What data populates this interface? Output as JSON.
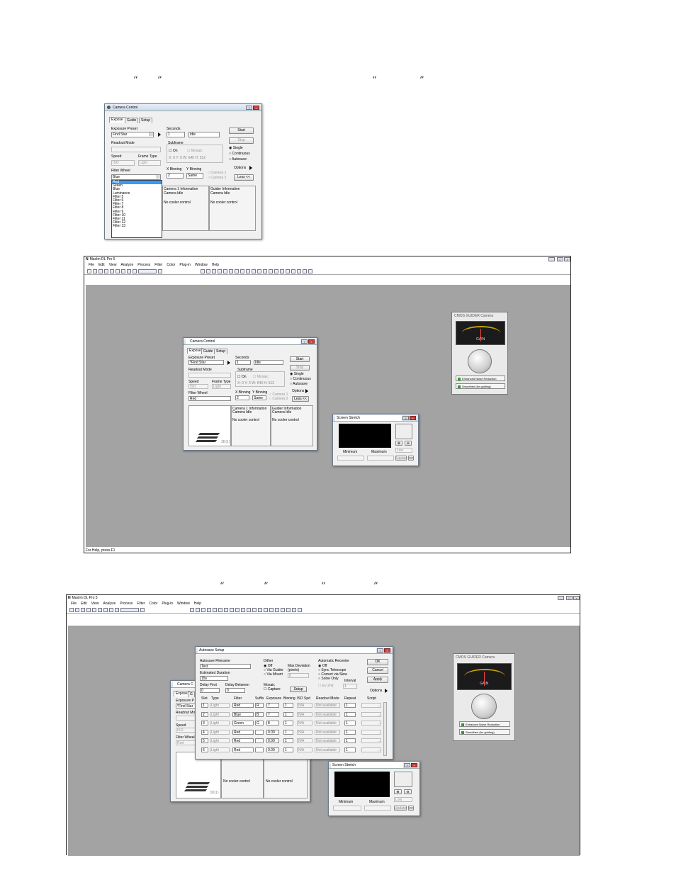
{
  "quotes": {
    "open": "“",
    "close": "”"
  },
  "camera_control": {
    "title": "Camera Control",
    "tabs": [
      "Expose",
      "Guide",
      "Setup"
    ],
    "exposure_preset_label": "Exposure Preset",
    "exposure_preset_value": "Find Star",
    "exposure_preset_value_2": "*Find Star",
    "seconds_label": "Seconds",
    "seconds_value": "1",
    "idle": "Idle",
    "start": "Start",
    "stop": "Stop",
    "readout_mode_label": "Readout Mode",
    "subframe_label": "Subframe",
    "on_label": "On",
    "mosaic_label": "Mosaic",
    "subframe_coords": "X: 0 Y: 0 W: 640 H: 512",
    "single": "Single",
    "continuous": "Continuous",
    "autosave": "Autosave",
    "speed_label": "Speed",
    "frame_type_label": "Frame Type",
    "speed_value": "ISO",
    "frame_type_value": "Light",
    "filter_wheel_label": "Filter Wheel",
    "filter_wheel_value": "Blue",
    "filter_wheel_value_2": "Red",
    "x_binning_label": "X Binning",
    "y_binning_label": "Y Binning",
    "x_binning_value": "2",
    "y_binning_value": "Same",
    "camera1": "Camera 1",
    "camera2": "Camera 2",
    "options": "Options",
    "less": "Less <<",
    "filter_options": [
      "Red",
      "Green",
      "Blue",
      "Luminance",
      "Filter 5",
      "Filter 6",
      "Filter 7",
      "Filter 8",
      "Filter 9",
      "Filter 10",
      "Filter 11",
      "Filter 12",
      "Filter 13"
    ],
    "camera_info_title": "Camera 1 Information",
    "camera_idle": "Camera Idle",
    "guider_info_title": "Guider Information",
    "no_cooler": "No cooler control",
    "logo_text": "3D(1)"
  },
  "maxim": {
    "title": "MaxIm DL Pro 5",
    "menus": [
      "File",
      "Edit",
      "View",
      "Analyze",
      "Process",
      "Filter",
      "Color",
      "Plug-in",
      "Window",
      "Help"
    ],
    "status": "For Help, press F1"
  },
  "cmos_guider": {
    "title": "CMOS GUIDER Camera",
    "scale": [
      "0",
      "10",
      "20",
      "30",
      "40",
      "50",
      "60",
      "70",
      "80",
      "90",
      "100"
    ],
    "gain_label": "GAIN",
    "noise_btn": "Enhanced Noise Reduction",
    "smooth_btn": "Smoothen (for guiding)"
  },
  "screen_stretch": {
    "title": "Screen Stretch",
    "minimum": "Minimum",
    "maximum": "Maximum",
    "mode": "Low",
    "update": "Update",
    "more": ">>"
  },
  "autosave": {
    "title": "Autosave Setup",
    "filename_label": "Autosave Filename",
    "filename_value": "Test",
    "est_duration_label": "Estimated Duration",
    "est_duration_value": "15s",
    "delay_first_label": "Delay First",
    "delay_between_label": "Delay Between",
    "delay_first_value": "0",
    "delay_between_value": "0",
    "dither_label": "Dither",
    "dither_off": "Off",
    "via_guider": "Via Guider",
    "via_mount": "Via Mount",
    "max_dev_label": "Max Deviation (pixels)",
    "max_dev_value": "0",
    "auto_recenter_label": "Automatic Recenter",
    "recenter_off": "Off",
    "sync_telescope": "Sync Telescope",
    "correct_slew": "Correct via Slew",
    "solve_only": "Solve Only",
    "interval_label": "Interval",
    "interval_value": "1",
    "mosaic_label": "Mosaic",
    "capture": "Capture",
    "setup_btn": "Setup",
    "every_nth": "Ev 2nd",
    "ok": "OK",
    "cancel": "Cancel",
    "apply": "Apply",
    "options": "Options",
    "columns": [
      "Slot",
      "Type",
      "Filter",
      "Suffix",
      "Exposure",
      "Binning",
      "ISO Spd",
      "Readout Mode",
      "Repeat",
      "Script"
    ],
    "rows": [
      {
        "slot": "1",
        "type": "Light",
        "filter": "Red",
        "suffix": "R",
        "exposure": "7",
        "binning": "1",
        "iso": "N/A",
        "readout": "Not available",
        "repeat": "1",
        "script": "..."
      },
      {
        "slot": "2",
        "type": "Light",
        "filter": "Blue",
        "suffix": "B",
        "exposure": "7",
        "binning": "1",
        "iso": "N/A",
        "readout": "Not available",
        "repeat": "1",
        "script": "..."
      },
      {
        "slot": "3",
        "type": "Light",
        "filter": "Green",
        "suffix": "G",
        "exposure": "8",
        "binning": "1",
        "iso": "N/A",
        "readout": "Not available",
        "repeat": "1",
        "script": "..."
      },
      {
        "slot": "4",
        "type": "Light",
        "filter": "Red",
        "suffix": "",
        "exposure": "0.00",
        "binning": "1",
        "iso": "N/A",
        "readout": "Not available",
        "repeat": "1",
        "script": "..."
      },
      {
        "slot": "5",
        "type": "Light",
        "filter": "Red",
        "suffix": "",
        "exposure": "0.00",
        "binning": "1",
        "iso": "N/A",
        "readout": "Not available",
        "repeat": "1",
        "script": "..."
      },
      {
        "slot": "6",
        "type": "Light",
        "filter": "Red",
        "suffix": "",
        "exposure": "0.00",
        "binning": "1",
        "iso": "N/A",
        "readout": "Not available",
        "repeat": "1",
        "script": "..."
      }
    ]
  },
  "behind_camera_panel": {
    "title": "Camera C",
    "tab": "Expose",
    "tab2": "G",
    "exposure_preset_label": "Exposure P",
    "exposure_value": "*Find Star",
    "readout_label": "Readout Mo",
    "speed_label": "Speed",
    "speed_value": "ISO",
    "filter_label": "Filter Wheel",
    "filter_value": "Red"
  }
}
